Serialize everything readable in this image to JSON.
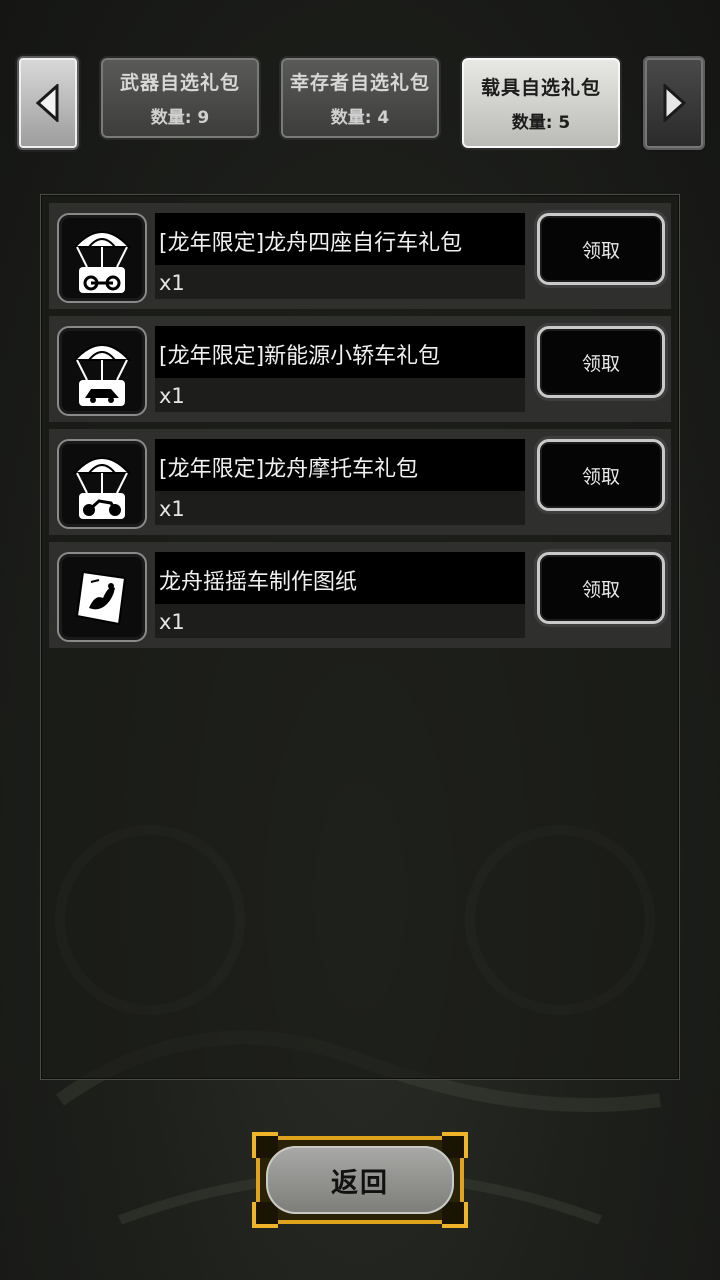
{
  "tabs": [
    {
      "title": "武器自选礼包",
      "count": "数量: 9"
    },
    {
      "title": "幸存者自选礼包",
      "count": "数量: 4"
    },
    {
      "title": "载具自选礼包",
      "count": "数量: 5"
    }
  ],
  "active_tab": 2,
  "items": [
    {
      "name": "[龙年限定]龙舟四座自行车礼包",
      "qty": "x1",
      "button": "领取",
      "icon": "parachute-bicycle-icon"
    },
    {
      "name": "[龙年限定]新能源小轿车礼包",
      "qty": "x1",
      "button": "领取",
      "icon": "parachute-car-icon"
    },
    {
      "name": "[龙年限定]龙舟摩托车礼包",
      "qty": "x1",
      "button": "领取",
      "icon": "parachute-motorcycle-icon"
    },
    {
      "name": "龙舟摇摇车制作图纸",
      "qty": "x1",
      "button": "领取",
      "icon": "blueprint-scroll-icon"
    }
  ],
  "back_button": "返回",
  "colors": {
    "accent_gold": "#e0a41c",
    "active_tab": "#dcdcd8"
  }
}
